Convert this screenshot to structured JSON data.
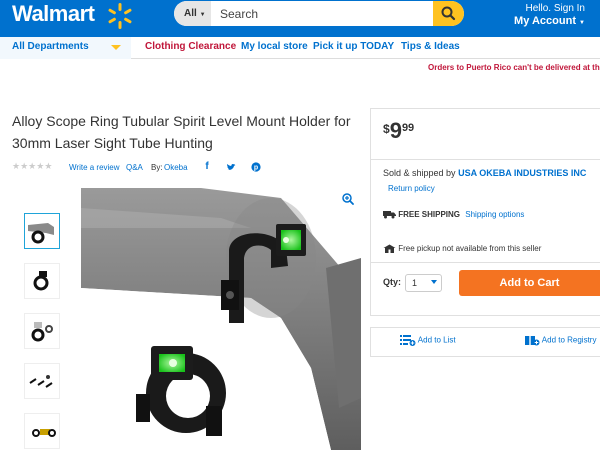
{
  "header": {
    "logo": "Walmart",
    "search": {
      "dept": "All",
      "placeholder": "Search"
    },
    "account": {
      "hello": "Hello. Sign In",
      "label": "My Account"
    }
  },
  "nav": {
    "departments": "All Departments",
    "links": [
      "Clothing Clearance",
      "My local store",
      "Pick it up TODAY",
      "Tips & Ideas"
    ]
  },
  "notice": "Orders to Puerto Rico can't be delivered at th",
  "product": {
    "title": "Alloy Scope Ring Tubular Spirit Level Mount Holder for 30mm Laser Sight Tube Hunting",
    "write_review": "Write a review",
    "qa": "Q&A",
    "by_label": "By:",
    "brand": "Okeba",
    "rating": 0
  },
  "buybox": {
    "price": {
      "dollar": "$",
      "whole": "9",
      "cents": "99"
    },
    "sold_by_label": "Sold & shipped by",
    "seller": "USA OKEBA INDUSTRIES INC",
    "return_policy": "Return policy",
    "free_shipping": "FREE SHIPPING",
    "shipping_options": "Shipping options",
    "pickup": "Free pickup not available from this seller",
    "qty_label": "Qty:",
    "qty_value": "1",
    "add_to_cart": "Add to Cart",
    "add_to_list": "Add to List",
    "add_to_registry": "Add to Registry"
  },
  "colors": {
    "brand_blue": "#0071ce",
    "spark_yellow": "#ffc220",
    "cart_orange": "#f47321",
    "notice_red": "#c0163a"
  },
  "icons": [
    "search-icon",
    "spark-logo-icon",
    "facebook-icon",
    "twitter-icon",
    "pinterest-icon",
    "zoom-icon",
    "truck-icon",
    "store-icon",
    "list-icon",
    "registry-icon"
  ]
}
